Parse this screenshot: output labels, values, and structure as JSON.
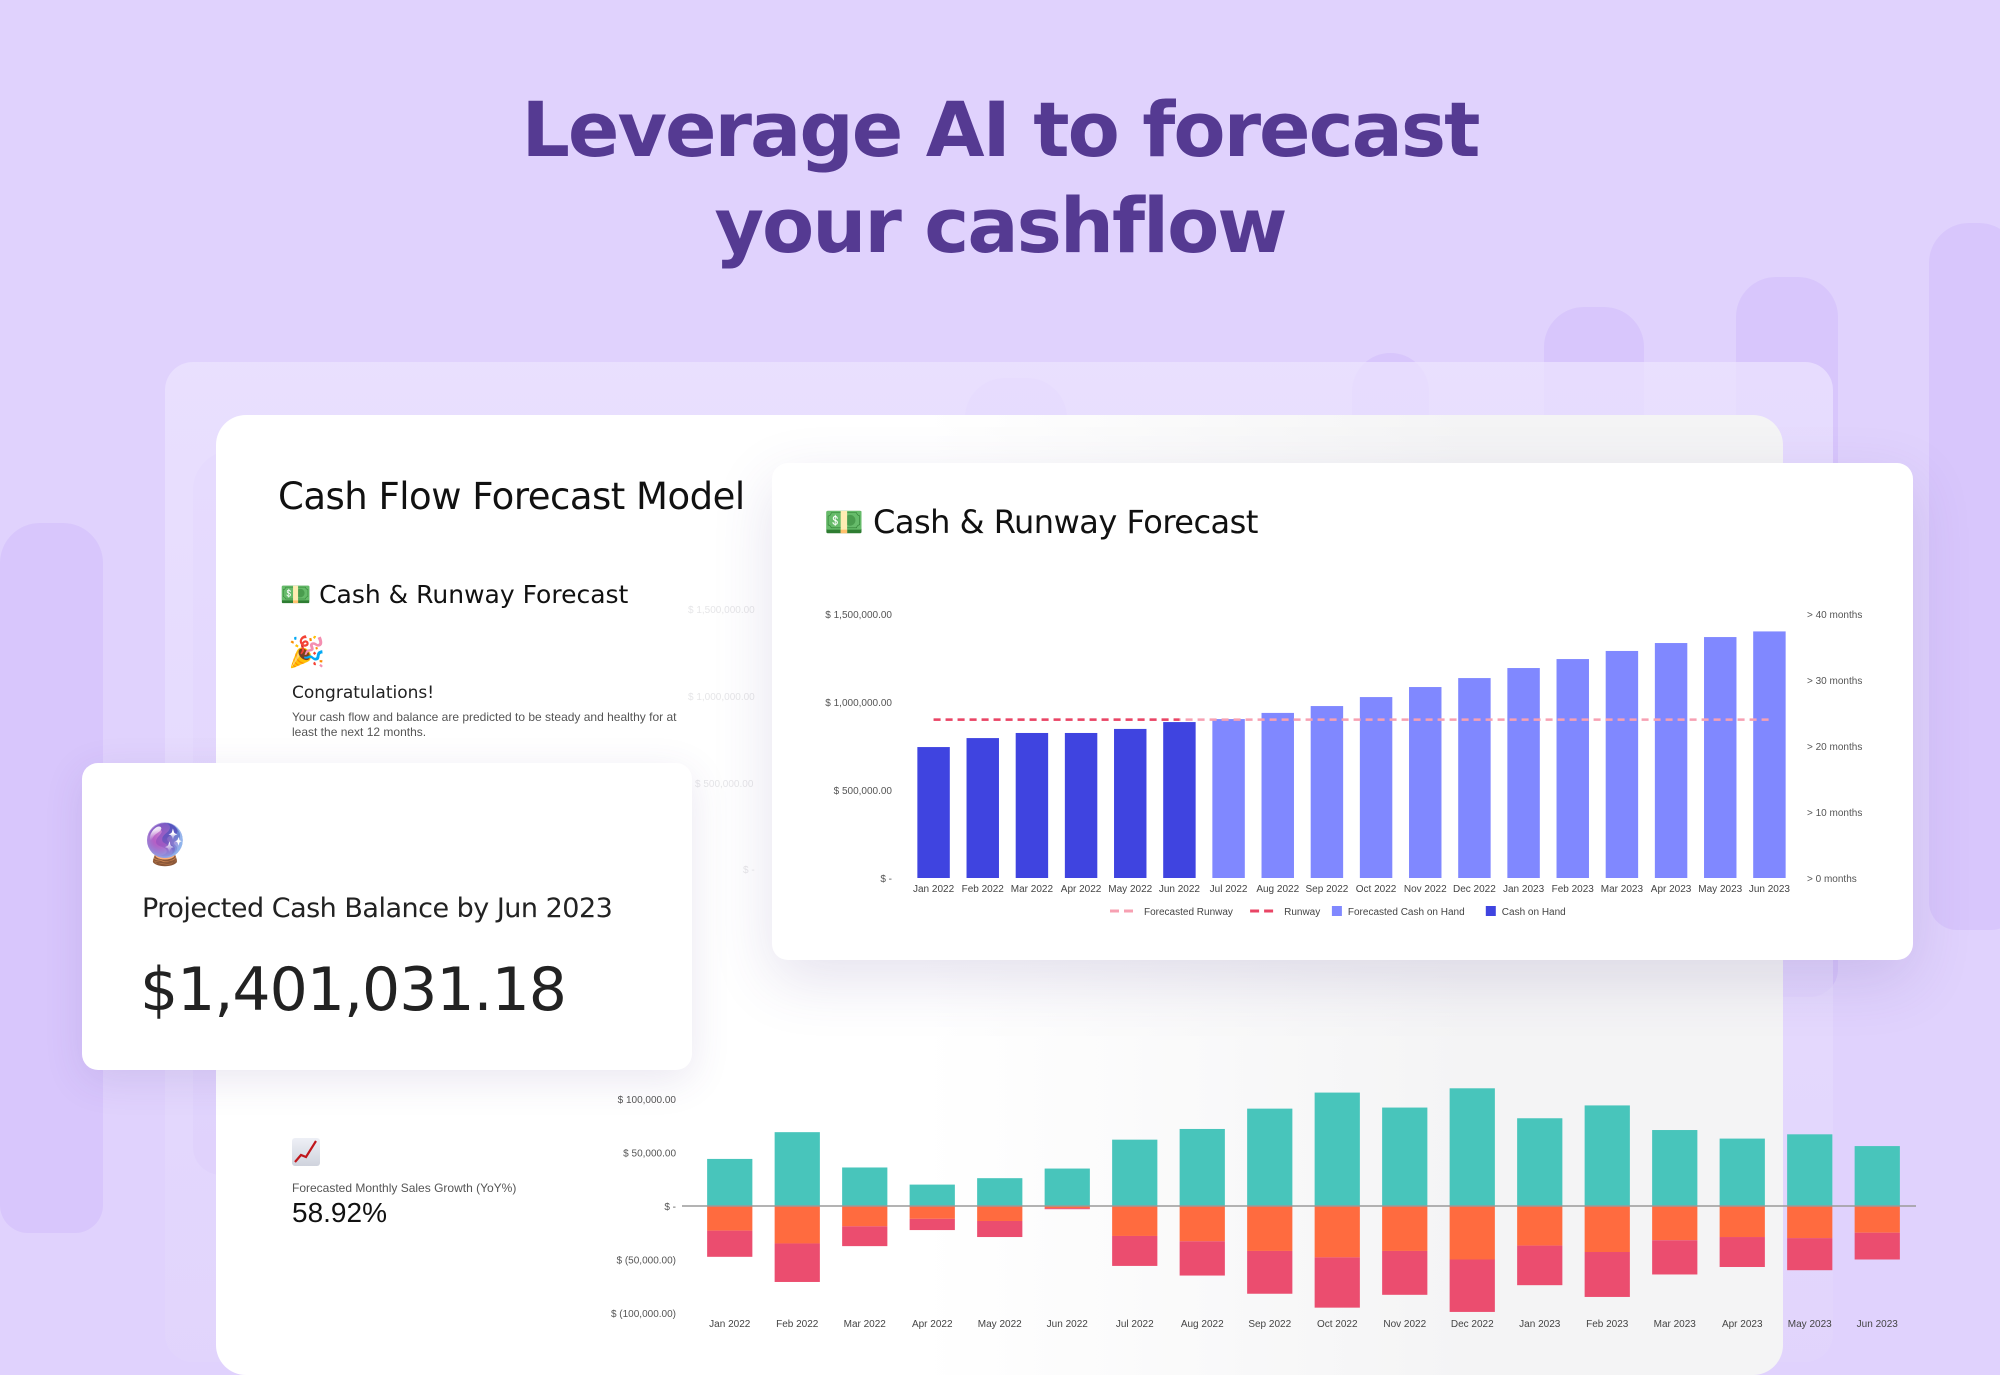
{
  "headline": {
    "line1": "Leverage AI to forecast",
    "line2": "your cashflow"
  },
  "main_card": {
    "title": "Cash Flow Forecast Model",
    "section_icon": "money-bill-icon",
    "section_emoji": "💵",
    "section_title": "Cash & Runway Forecast",
    "congrats_emoji": "🎉",
    "congrats_title": "Congratulations!",
    "congrats_body": "Your cash flow and balance are predicted to be steady and healthy for at least the next 12 months.",
    "ghost_axis": [
      "$ 1,500,000.00",
      "$ 1,000,000.00",
      "$ 500,000.00",
      "$ -"
    ],
    "growth_label": "Forecasted Monthly Sales Growth (YoY%)",
    "growth_value": "58.92%"
  },
  "projected_card": {
    "emoji": "🔮",
    "label": "Projected Cash Balance by Jun 2023",
    "value": "$1,401,031.18"
  },
  "runway_card": {
    "emoji": "💵",
    "title": "Cash & Runway Forecast"
  },
  "colors": {
    "cash_on_hand": "#3F44E0",
    "forecasted_cash": "#8088FF",
    "runway": "#E94565",
    "forecasted_runway": "#F7A0B2",
    "inflow": "#48C5BB",
    "outflow_a": "#FF6B3F",
    "outflow_b": "#EB4D6F",
    "headline": "#553A92"
  },
  "chart_data": [
    {
      "type": "bar",
      "title": "Cash & Runway Forecast",
      "categories": [
        "Jan 2022",
        "Feb 2022",
        "Mar 2022",
        "Apr 2022",
        "May 2022",
        "Jun 2022",
        "Jul 2022",
        "Aug 2022",
        "Sep 2022",
        "Oct 2022",
        "Nov 2022",
        "Dec 2022",
        "Jan 2023",
        "Feb 2023",
        "Mar 2023",
        "Apr 2023",
        "May 2023",
        "Jun 2023"
      ],
      "series": [
        {
          "name": "Cash on Hand",
          "values": [
            744000,
            795000,
            824000,
            824000,
            847000,
            886000,
            null,
            null,
            null,
            null,
            null,
            null,
            null,
            null,
            null,
            null,
            null,
            null
          ]
        },
        {
          "name": "Forecasted Cash on Hand",
          "values": [
            null,
            null,
            null,
            null,
            null,
            null,
            903000,
            938000,
            977000,
            1028000,
            1085000,
            1136000,
            1193000,
            1244000,
            1290000,
            1335000,
            1369000,
            1401031.18
          ]
        },
        {
          "name": "Runway",
          "axis": "right",
          "values": [
            24,
            24,
            24,
            24,
            24,
            24
          ],
          "unit": "months"
        },
        {
          "name": "Forecasted Runway",
          "axis": "right",
          "values": [
            24,
            24,
            24,
            24,
            24,
            24,
            24,
            24,
            24,
            24,
            24,
            24,
            24,
            24,
            24,
            24,
            24,
            24
          ],
          "unit": "months"
        }
      ],
      "ylim": [
        0,
        1500000
      ],
      "yticks": [
        "$ -",
        "$ 500,000.00",
        "$ 1,000,000.00",
        "$ 1,500,000.00"
      ],
      "y2lim": [
        0,
        40
      ],
      "y2ticks": [
        "> 0 months",
        "> 10 months",
        "> 20 months",
        "> 30 months",
        "> 40 months"
      ],
      "legend": [
        "Forecasted Runway",
        "Runway",
        "Forecasted Cash on Hand",
        "Cash on Hand"
      ],
      "legend_position": "bottom",
      "xlabel": "",
      "ylabel": ""
    },
    {
      "type": "bar",
      "stacked": true,
      "title": "",
      "categories": [
        "Jan 2022",
        "Feb 2022",
        "Mar 2022",
        "Apr 2022",
        "May 2022",
        "Jun 2022",
        "Jul 2022",
        "Aug 2022",
        "Sep 2022",
        "Oct 2022",
        "Nov 2022",
        "Dec 2022",
        "Jan 2023",
        "Feb 2023",
        "Mar 2023",
        "Apr 2023",
        "May 2023",
        "Jun 2023"
      ],
      "series": [
        {
          "name": "Inflow",
          "values": [
            44000,
            69000,
            36000,
            20000,
            26000,
            35000,
            62000,
            72000,
            91000,
            106000,
            92000,
            110000,
            82000,
            94000,
            71000,
            63000,
            67000,
            56000
          ]
        },
        {
          "name": "Outflow A",
          "values": [
            -23000,
            -35000,
            -19000,
            -12000,
            -14000,
            -2000,
            -28000,
            -33000,
            -42000,
            -48000,
            -42000,
            -50000,
            -37000,
            -43000,
            -32000,
            -29000,
            -30000,
            -25000
          ]
        },
        {
          "name": "Outflow B",
          "values": [
            -24500,
            -36000,
            -18500,
            -10500,
            -15000,
            -1000,
            -28000,
            -32000,
            -40000,
            -47000,
            -41000,
            -49000,
            -37000,
            -42000,
            -32000,
            -28000,
            -30000,
            -25000
          ]
        }
      ],
      "ylim": [
        -100000,
        100000
      ],
      "yticks": [
        "$ (100,000.00)",
        "$ (50,000.00)",
        "$ -",
        "$ 50,000.00",
        "$ 100,000.00"
      ],
      "xlabel": "",
      "ylabel": ""
    }
  ]
}
